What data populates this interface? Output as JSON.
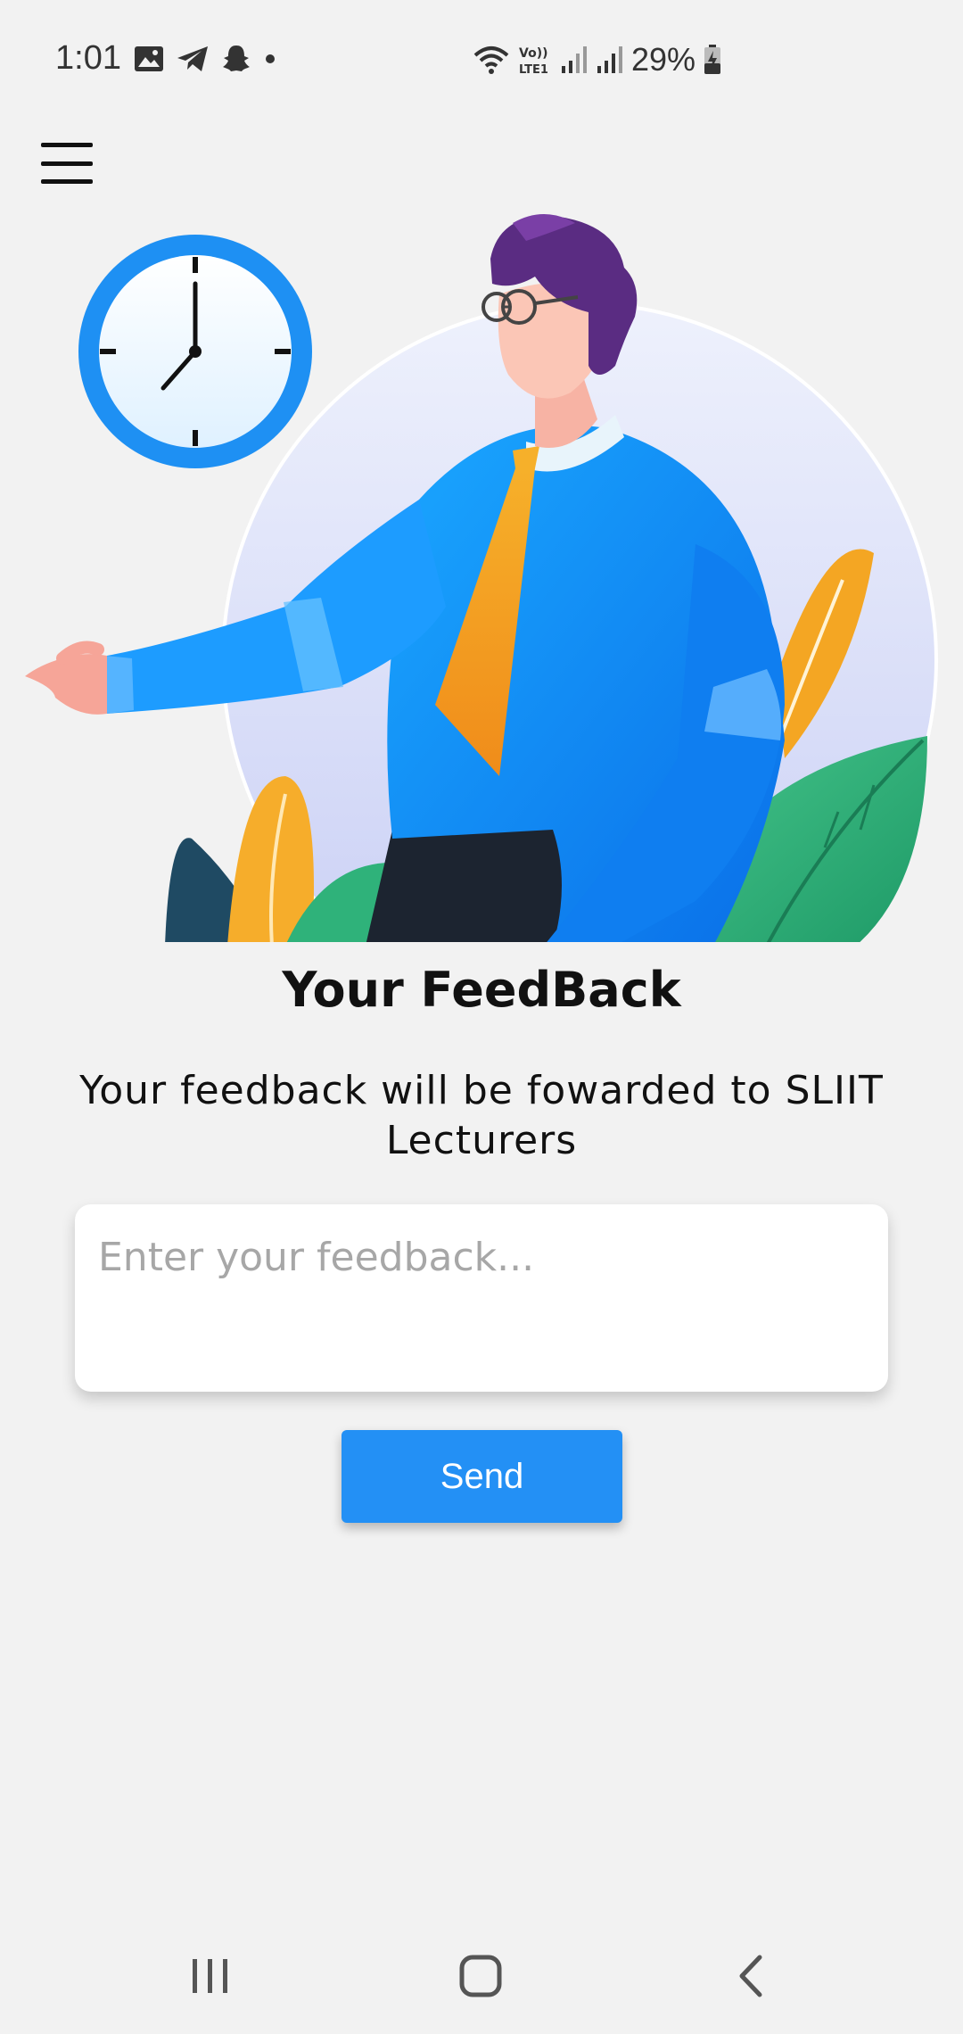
{
  "status_bar": {
    "time": "1:01",
    "notification_icons": [
      "image-icon",
      "telegram-icon",
      "snapchat-icon",
      "dot-icon"
    ],
    "system_icons": [
      "wifi-icon",
      "volte-icon",
      "signal-icon",
      "signal-icon",
      "battery-charging-icon"
    ],
    "battery_percent": "29%"
  },
  "header": {
    "menu_icon": "hamburger-menu-icon"
  },
  "hero": {
    "illustration": "man-with-clock-illustration"
  },
  "main": {
    "title": "Your FeedBack",
    "subtitle": "Your feedback will be fowarded to SLIIT Lecturers",
    "feedback_placeholder": "Enter your feedback...",
    "feedback_value": "",
    "send_label": "Send"
  },
  "nav_bar": {
    "icons": [
      "recent-apps-icon",
      "home-icon",
      "back-icon"
    ]
  },
  "colors": {
    "accent": "#2390f5",
    "background": "#f2f2f2"
  }
}
